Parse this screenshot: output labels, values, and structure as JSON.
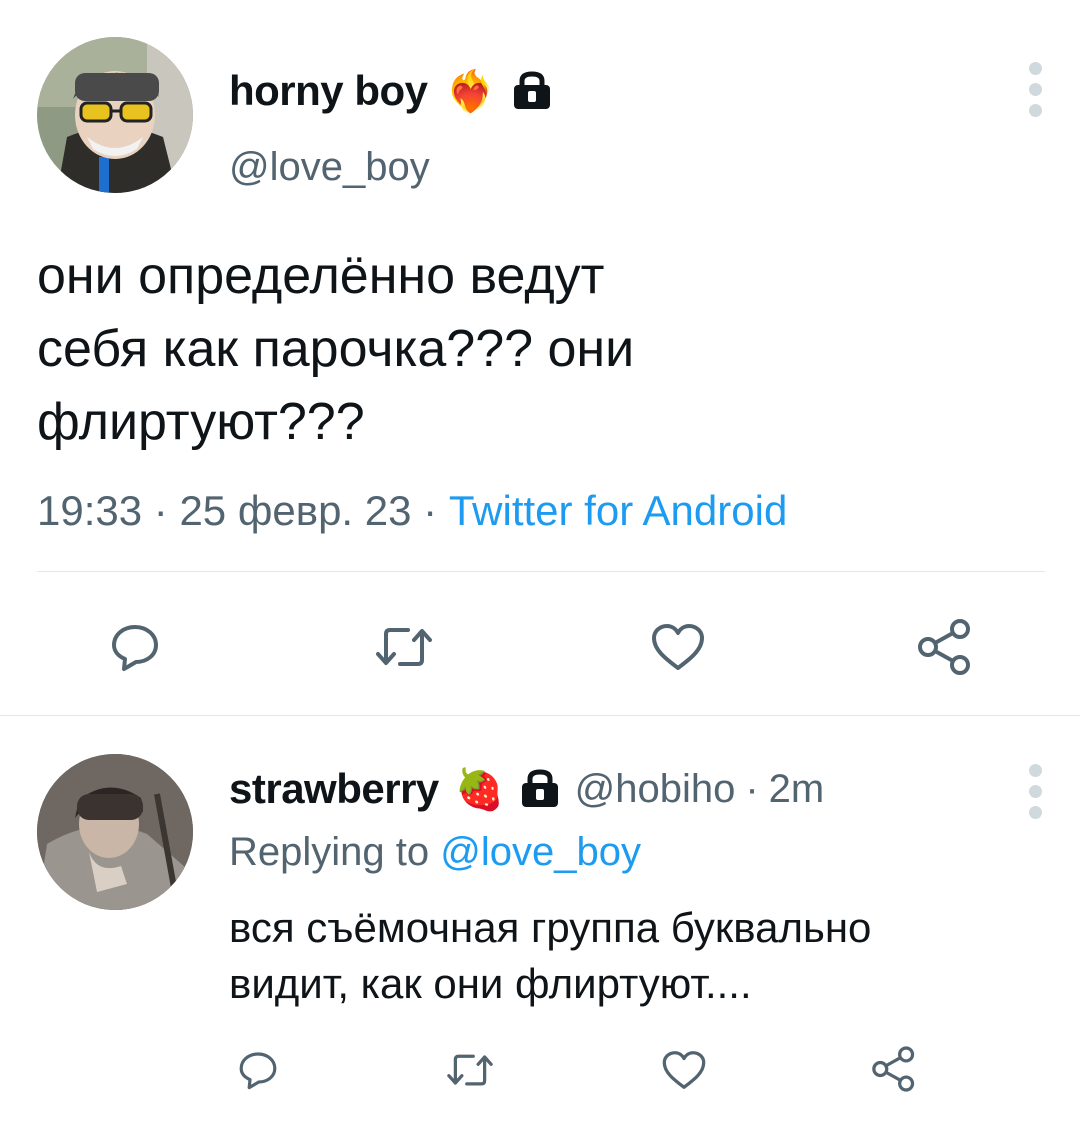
{
  "tweet": {
    "display_name": "horny boy",
    "emoji": "❤️‍🔥",
    "handle": "@love_boy",
    "text_lines": [
      "они определённо ведут",
      "себя как парочка??? они",
      "флиртуют???"
    ],
    "time": "19:33",
    "sep1": "·",
    "date": "25 февр. 23",
    "sep2": "·",
    "source": "Twitter for Android"
  },
  "reply": {
    "display_name": "strawberry",
    "emoji": "🍓",
    "handle": "@hobiho",
    "sep": "·",
    "age": "2m",
    "replying_prefix": "Replying to",
    "replying_handle": "@love_boy",
    "text_lines": [
      "вся съёмочная группа буквально",
      "видит, как они флиртуют...."
    ]
  },
  "icons": {
    "reply": "reply-icon",
    "retweet": "retweet-icon",
    "like": "heart-icon",
    "share": "share-icon",
    "lock": "lock-icon",
    "more": "more-vertical-icon"
  },
  "colors": {
    "text": "#0f1419",
    "muted": "#536471",
    "accent": "#1d9bf0",
    "icon": "#536471",
    "divider": "#e1e8ed"
  }
}
